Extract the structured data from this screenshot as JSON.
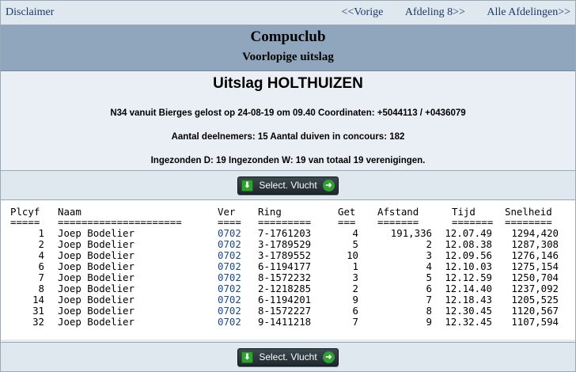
{
  "nav": {
    "disclaimer": "Disclaimer",
    "vorige": "<<Vorige",
    "afdeling": "Afdeling 8>>",
    "alle": "Alle Afdelingen>>"
  },
  "header": {
    "club": "Compuclub",
    "subtitle": "Voorlopige uitslag"
  },
  "info": {
    "title": "Uitslag HOLTHUIZEN",
    "line1": "N34 vanuit Bierges gelost op 24-08-19 om 09.40 Coordinaten: +5044113 / +0436079",
    "line2": "Aantal deelnemers: 15 Aantal duiven in concours: 182",
    "line3": "Ingezonden D: 19 Ingezonden W: 19 van totaal 19 verenigingen."
  },
  "button": {
    "label": "Select. Vlucht"
  },
  "table": {
    "headers": {
      "plcyf": "Plcyf",
      "naam": "Naam",
      "ver": "Ver",
      "ring": "Ring",
      "get": "Get",
      "afstand": "Afstand",
      "tijd": "Tijd",
      "snelheid": "Snelheid"
    },
    "separators": {
      "plcyf": "=====",
      "naam": "=====================",
      "ver": "====",
      "ring": "=========",
      "get": "===",
      "afstand": "=======",
      "tijd": "=======",
      "snelheid": "========"
    },
    "rows": [
      {
        "plcyf": "1",
        "naam": "Joep Bodelier",
        "ver": "0702",
        "ring": "7-1761203",
        "get": "4",
        "afstand": "191,336",
        "tijd": "12.07.49",
        "snelheid": "1294,420"
      },
      {
        "plcyf": "2",
        "naam": "Joep Bodelier",
        "ver": "0702",
        "ring": "3-1789529",
        "get": "5",
        "afstand": "2",
        "tijd": "12.08.38",
        "snelheid": "1287,308"
      },
      {
        "plcyf": "4",
        "naam": "Joep Bodelier",
        "ver": "0702",
        "ring": "3-1789552",
        "get": "10",
        "afstand": "3",
        "tijd": "12.09.56",
        "snelheid": "1276,146"
      },
      {
        "plcyf": "6",
        "naam": "Joep Bodelier",
        "ver": "0702",
        "ring": "6-1194177",
        "get": "1",
        "afstand": "4",
        "tijd": "12.10.03",
        "snelheid": "1275,154"
      },
      {
        "plcyf": "7",
        "naam": "Joep Bodelier",
        "ver": "0702",
        "ring": "8-1572232",
        "get": "3",
        "afstand": "5",
        "tijd": "12.12.59",
        "snelheid": "1250,704"
      },
      {
        "plcyf": "8",
        "naam": "Joep Bodelier",
        "ver": "0702",
        "ring": "2-1218285",
        "get": "2",
        "afstand": "6",
        "tijd": "12.14.40",
        "snelheid": "1237,092"
      },
      {
        "plcyf": "14",
        "naam": "Joep Bodelier",
        "ver": "0702",
        "ring": "6-1194201",
        "get": "9",
        "afstand": "7",
        "tijd": "12.18.43",
        "snelheid": "1205,525"
      },
      {
        "plcyf": "31",
        "naam": "Joep Bodelier",
        "ver": "0702",
        "ring": "8-1572227",
        "get": "6",
        "afstand": "8",
        "tijd": "12.30.45",
        "snelheid": "1120,567"
      },
      {
        "plcyf": "32",
        "naam": "Joep Bodelier",
        "ver": "0702",
        "ring": "9-1411218",
        "get": "7",
        "afstand": "9",
        "tijd": "12.32.45",
        "snelheid": "1107,594"
      }
    ]
  }
}
